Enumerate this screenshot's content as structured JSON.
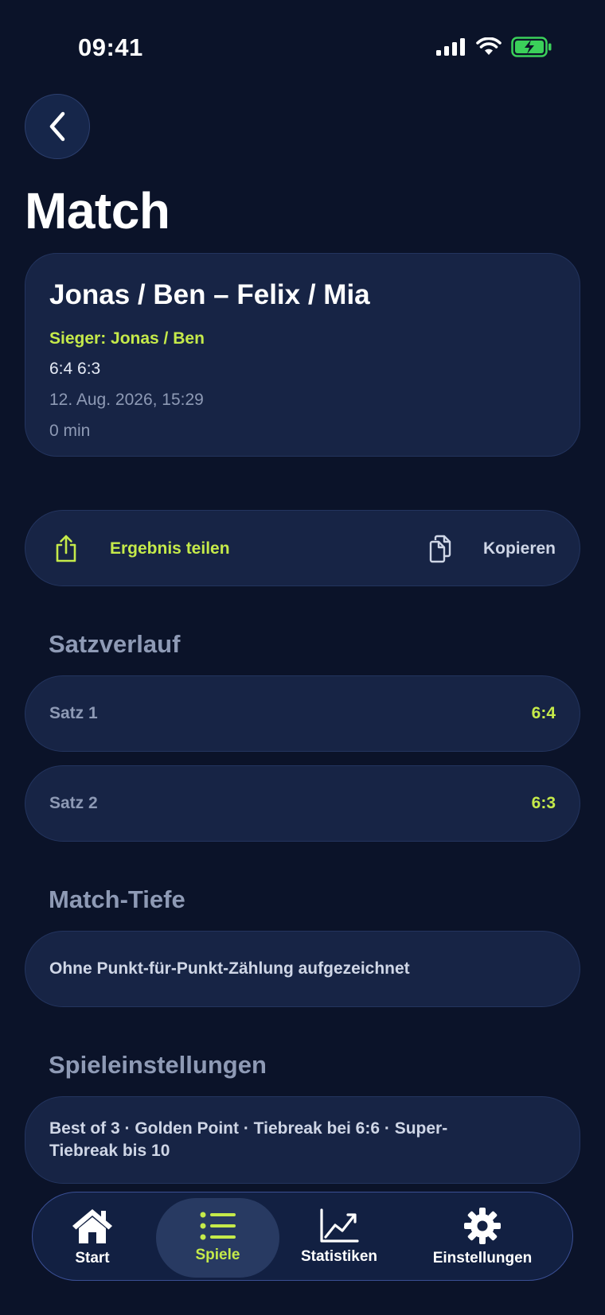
{
  "status_bar": {
    "time": "09:41"
  },
  "header": {
    "title": "Match"
  },
  "match": {
    "teams": "Jonas / Ben – Felix / Mia",
    "winner": "Sieger: Jonas / Ben",
    "score": "6:4 6:3",
    "date": "12. Aug. 2026, 15:29",
    "duration": "0 min"
  },
  "actions": {
    "share_label": "Ergebnis teilen",
    "copy_label": "Kopieren"
  },
  "sets_section": {
    "heading": "Satzverlauf",
    "sets": [
      {
        "label": "Satz 1",
        "score": "6:4"
      },
      {
        "label": "Satz 2",
        "score": "6:3"
      }
    ]
  },
  "depth_section": {
    "heading": "Match-Tiefe",
    "text": "Ohne Punkt-für-Punkt-Zählung aufgezeichnet"
  },
  "settings_section": {
    "heading": "Spieleinstellungen",
    "line1": "Best of 3 · Golden Point · Tiebreak bei 6:6 · Super-",
    "line2": "Tiebreak bis 10"
  },
  "tab_bar": {
    "tabs": [
      {
        "label": "Start",
        "icon": "home-icon"
      },
      {
        "label": "Spiele",
        "icon": "list-icon",
        "active": true
      },
      {
        "label": "Statistiken",
        "icon": "chart-icon"
      },
      {
        "label": "Einstellungen",
        "icon": "gear-icon"
      }
    ]
  },
  "colors": {
    "background": "#0b1329",
    "card": "#172445",
    "accent": "#c5ea4a",
    "muted": "#8e9ab5"
  }
}
